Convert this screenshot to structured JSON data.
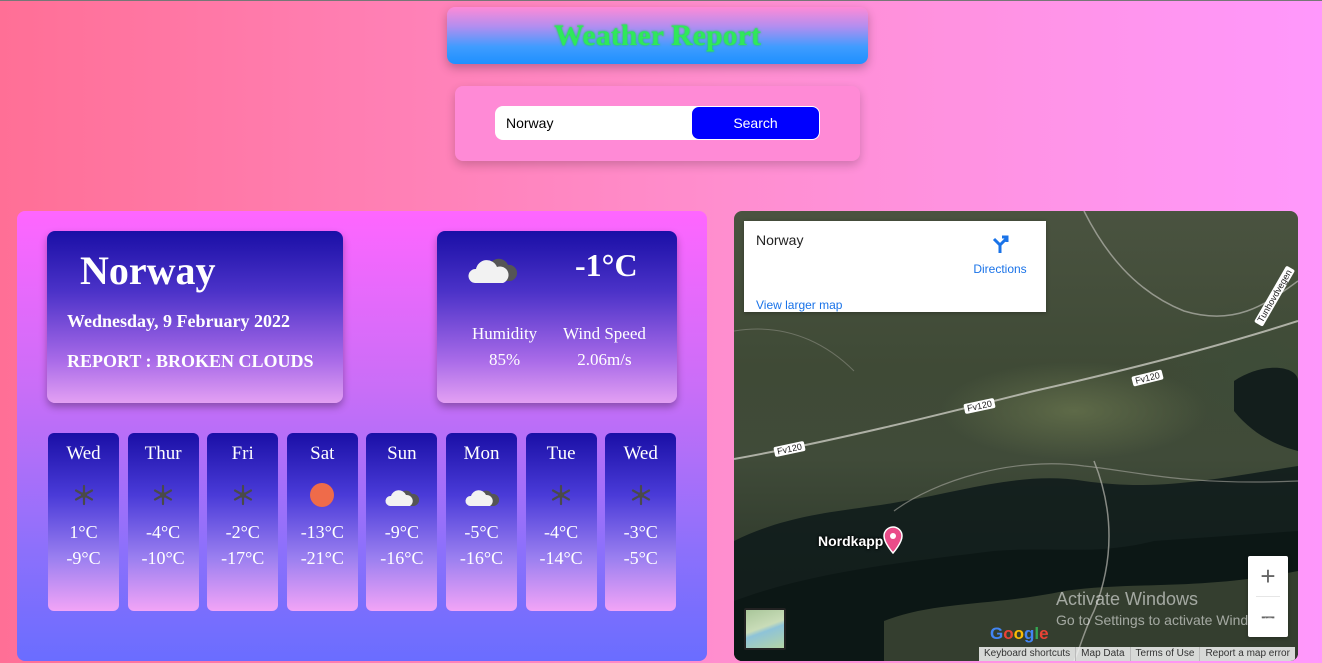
{
  "header": {
    "title": "Weather Report"
  },
  "search": {
    "value": "Norway",
    "button_label": "Search"
  },
  "current": {
    "city": "Norway",
    "date": "Wednesday, 9 February 2022",
    "report": "REPORT : BROKEN CLOUDS",
    "temperature": "-1°C",
    "icon": "broken-clouds-icon",
    "humidity_label": "Humidity",
    "humidity_value": "85%",
    "wind_label": "Wind Speed",
    "wind_value": "2.06m/s"
  },
  "forecast": [
    {
      "day": "Wed",
      "icon": "snow-icon",
      "high": "1°C",
      "low": "-9°C"
    },
    {
      "day": "Thur",
      "icon": "snow-icon",
      "high": "-4°C",
      "low": "-10°C"
    },
    {
      "day": "Fri",
      "icon": "snow-icon",
      "high": "-2°C",
      "low": "-17°C"
    },
    {
      "day": "Sat",
      "icon": "sun-icon",
      "high": "-13°C",
      "low": "-21°C"
    },
    {
      "day": "Sun",
      "icon": "broken-clouds-icon",
      "high": "-9°C",
      "low": "-16°C"
    },
    {
      "day": "Mon",
      "icon": "broken-clouds-icon",
      "high": "-5°C",
      "low": "-16°C"
    },
    {
      "day": "Tue",
      "icon": "snow-icon",
      "high": "-4°C",
      "low": "-14°C"
    },
    {
      "day": "Wed",
      "icon": "snow-icon",
      "high": "-3°C",
      "low": "-5°C"
    }
  ],
  "map": {
    "place_title": "Norway",
    "directions_label": "Directions",
    "view_larger_label": "View larger map",
    "marker_label": "Nordkapp",
    "road_labels": [
      "Fv120",
      "Fv120",
      "Fv120",
      "Tunhovdvegen"
    ],
    "logo_text": "Google",
    "zoom_in": "+",
    "zoom_out": "−",
    "attribution": [
      "Keyboard shortcuts",
      "Map Data",
      "Terms of Use",
      "Report a map error"
    ]
  },
  "watermark": {
    "line1": "Activate Windows",
    "line2": "Go to Settings to activate Windows."
  }
}
